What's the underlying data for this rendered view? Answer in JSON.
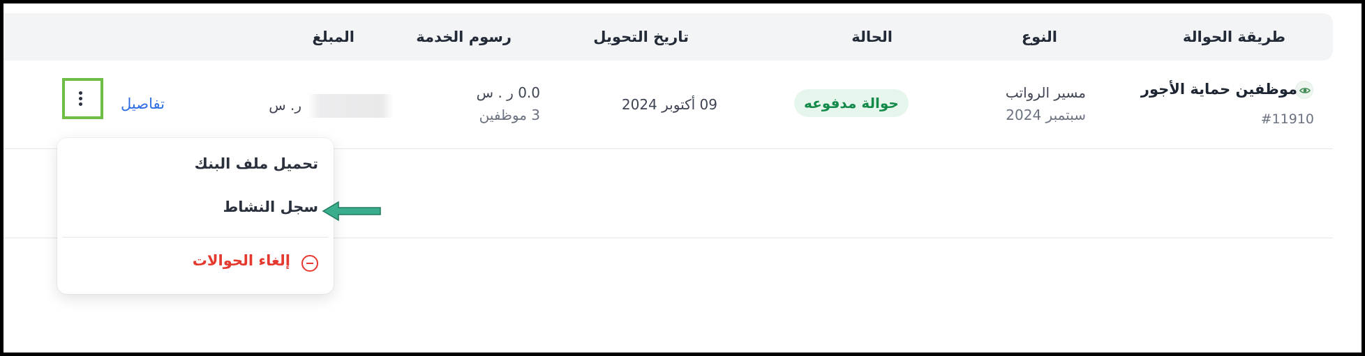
{
  "table": {
    "headers": {
      "transfer_method": "طريقة الحوالة",
      "type": "النوع",
      "status": "الحالة",
      "transfer_date": "تاريخ التحويل",
      "service_fees": "رسوم الخدمة",
      "amount": "المبلغ"
    },
    "row": {
      "method_title": "موظفين حماية الأجور",
      "method_id": "#11910",
      "type_line1": "مسير الرواتب",
      "type_line2": "سبتمبر 2024",
      "status": "حوالة مدفوعه",
      "transfer_date": "09 أكتوبر 2024",
      "fees_line1": "0.0 ر . س",
      "fees_line2": "3 موظفين",
      "amount_currency": "ر. س",
      "details_label": "تفاصيل"
    }
  },
  "menu": {
    "download_bank_file": "تحميل ملف البنك",
    "activity_log": "سجل النشاط",
    "cancel_transfers": "إلغاء الحوالات"
  },
  "colors": {
    "highlight_border": "#6ebd45",
    "status_green": "#13894a",
    "link_blue": "#2d6ee6",
    "danger_red": "#e5382e",
    "arrow_teal": "#3aae8c"
  }
}
